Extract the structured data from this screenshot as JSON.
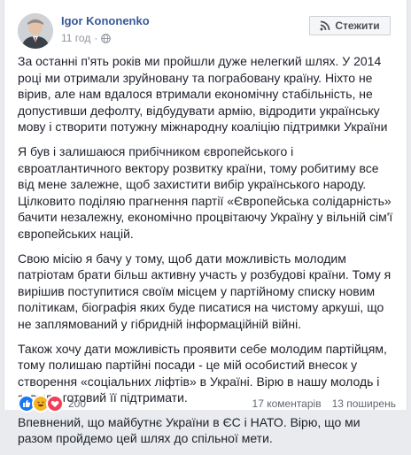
{
  "author": {
    "name": "Igor Kononenko"
  },
  "meta": {
    "time": "11 год",
    "visibility_icon": "globe-icon"
  },
  "actions": {
    "follow_label": "Стежити"
  },
  "post": {
    "paragraphs": [
      "За останні п'ять років ми пройшли дуже нелегкий шлях. У 2014 році ми отримали зруйновану та пограбовану країну. Ніхто не вірив, але нам вдалося втримали економічну стабільність, не допустивши дефолту, відбудувати армію, відродити українську мову і створити потужну міжнародну коаліцію підтримки України",
      "Я був і залишаюся прибічником європейського і євроатлантичного вектору розвитку країни, тому робитиму все від мене залежне, щоб захистити вибір українського народу. Цілковито поділяю прагнення партії «Європейська солідарність» бачити незалежну, економічно процвітаючу Україну у вільній сім'ї європейських націй.",
      "Свою місію я бачу у тому, щоб дати можливість молодим патріотам брати більш активну участь у розбудові країни. Тому я вирішив поступитися своїм місцем у партійному списку новим політикам, біографія яких буде писатися на чистому аркуші, що не заплямований у гібридній інформаційній війні.",
      "Також хочу дати можливість проявити себе молодим партійцям, тому полишаю партійні посади - це мій особистий внесок у створення «соціальних ліфтів» в Україні. Вірю в нашу молодь і завжди готовий її підтримати.",
      "Впевнений, що майбутнє України в ЄС і НАТО. Вірю, що ми разом пройдемо цей шлях до спільної мети."
    ]
  },
  "footer": {
    "reactions": [
      "like",
      "haha",
      "love"
    ],
    "reaction_count": "200",
    "comments": "17 коментарів",
    "shares": "13 поширень"
  },
  "colors": {
    "link": "#385898",
    "like": "#1877f2",
    "haha": "#f7b125",
    "love": "#f33e58"
  }
}
